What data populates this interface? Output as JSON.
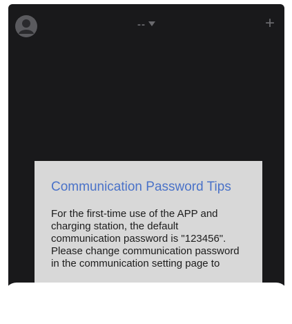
{
  "header": {
    "device_selector_label": "--",
    "avatar_icon": "user-avatar-icon",
    "dropdown_icon": "caret-down-icon",
    "add_icon": "plus-icon",
    "add_label": "+"
  },
  "dialog": {
    "title": "Communication Password Tips",
    "body": "For the first-time use of the APP and charging station, the default communication password is \"123456\". Please change communication password in the communication setting page to"
  },
  "colors": {
    "app_background": "#19191b",
    "dialog_background": "#d8d8d8",
    "title_accent": "#4a72c8",
    "icon_gray": "#6a6a6e"
  }
}
